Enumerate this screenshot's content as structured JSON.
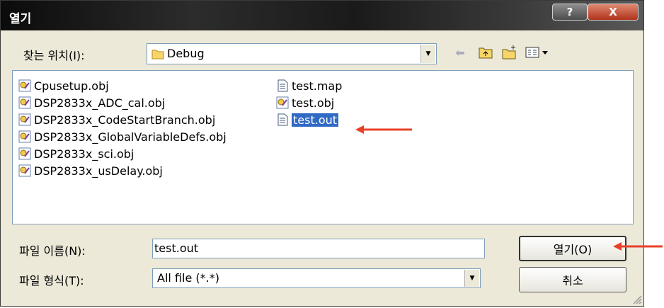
{
  "window": {
    "title": "열기",
    "help_label": "?",
    "close_label": "X"
  },
  "look_in": {
    "label": "찾는 위치(I):",
    "value": "Debug"
  },
  "files": [
    {
      "name": "Cpusetup.obj",
      "type": "obj"
    },
    {
      "name": "DSP2833x_ADC_cal.obj",
      "type": "obj"
    },
    {
      "name": "DSP2833x_CodeStartBranch.obj",
      "type": "obj"
    },
    {
      "name": "DSP2833x_GlobalVariableDefs.obj",
      "type": "obj"
    },
    {
      "name": "DSP2833x_sci.obj",
      "type": "obj"
    },
    {
      "name": "DSP2833x_usDelay.obj",
      "type": "obj"
    },
    {
      "name": "test.map",
      "type": "text"
    },
    {
      "name": "test.obj",
      "type": "obj"
    },
    {
      "name": "test.out",
      "type": "text",
      "selected": true
    }
  ],
  "filename": {
    "label": "파일 이름(N):",
    "value": "test.out"
  },
  "filetype": {
    "label": "파일 형식(T):",
    "value": "All file (*.*)"
  },
  "buttons": {
    "open": "열기(O)",
    "cancel": "취소"
  },
  "colors": {
    "selection": "#316ac5",
    "annotation_arrow": "#e8412a"
  }
}
